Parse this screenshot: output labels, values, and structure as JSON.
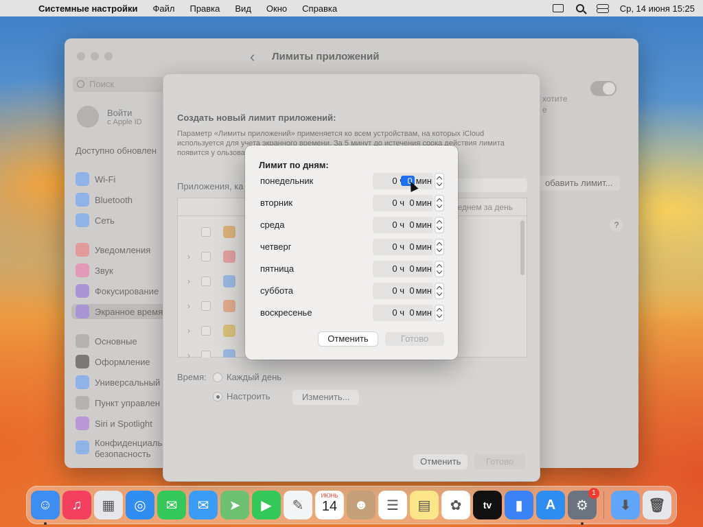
{
  "menubar": {
    "app_name": "Системные настройки",
    "items": [
      "Файл",
      "Правка",
      "Вид",
      "Окно",
      "Справка"
    ],
    "clock": "Ср, 14 июня  15:25"
  },
  "window": {
    "title": "Лимиты приложений",
    "search_placeholder": "Поиск",
    "account_name": "Войти",
    "account_sub": "с Apple ID",
    "update_note": "Доступно обновлен",
    "sidebar": [
      {
        "label": "Wi-Fi",
        "color": "#3b82f6"
      },
      {
        "label": "Bluetooth",
        "color": "#3b82f6"
      },
      {
        "label": "Сеть",
        "color": "#3b82f6"
      },
      {
        "label": "Уведомления",
        "color": "#ef4444"
      },
      {
        "label": "Звук",
        "color": "#ec4899"
      },
      {
        "label": "Фокусирование",
        "color": "#6d28d9"
      },
      {
        "label": "Экранное время",
        "color": "#7c3aed"
      },
      {
        "label": "Основные",
        "color": "#9ca3af"
      },
      {
        "label": "Оформление",
        "color": "#111827"
      },
      {
        "label": "Универсальный",
        "color": "#3b82f6"
      },
      {
        "label": "Пункт управлен",
        "color": "#9ca3af"
      },
      {
        "label": "Siri и Spotlight",
        "color": "#a855f7"
      },
      {
        "label": "Конфиденциаль",
        "color": "#3b82f6"
      },
      {
        "label": "безопасность",
        "color": ""
      }
    ],
    "right_hint_1": "хотите",
    "right_hint_2": "е",
    "add_limit": "обавить лимит...",
    "help": "?"
  },
  "sheet": {
    "title": "Создать новый лимит приложений:",
    "description": "Параметр «Лимиты приложений» применяется ко всем устройствам, на которых iCloud используется для учета экранного времени. За 5 минут до истечения срока действия лимита появится у                                                             ользовать на все приложения этой",
    "apps_label": "Приложения, ка",
    "table_header_right": "реднем за день",
    "time_label": "Время:",
    "every_day": "Каждый день",
    "custom": "Настроить",
    "change": "Изменить...",
    "cancel": "Отменить",
    "done": "Готово"
  },
  "dialog": {
    "title": "Лимит по дням:",
    "hours_unit": "ч",
    "minutes_unit": "мин",
    "days": [
      {
        "name": "понедельник",
        "hours": "0",
        "minutes": "0",
        "selected": true
      },
      {
        "name": "вторник",
        "hours": "0",
        "minutes": "0",
        "selected": false
      },
      {
        "name": "среда",
        "hours": "0",
        "minutes": "0",
        "selected": false
      },
      {
        "name": "четверг",
        "hours": "0",
        "minutes": "0",
        "selected": false
      },
      {
        "name": "пятница",
        "hours": "0",
        "minutes": "0",
        "selected": false
      },
      {
        "name": "суббота",
        "hours": "0",
        "minutes": "0",
        "selected": false
      },
      {
        "name": "воскресенье",
        "hours": "0",
        "minutes": "0",
        "selected": false
      }
    ],
    "cancel": "Отменить",
    "done": "Готово"
  },
  "dock": {
    "apps": [
      {
        "name": "finder-icon",
        "color": "#3d8ef0",
        "glyph": "☺",
        "running": true
      },
      {
        "name": "music-icon",
        "color": "#f43f5e",
        "glyph": "♫",
        "running": false
      },
      {
        "name": "launchpad-icon",
        "color": "#e5e7eb",
        "glyph": "▦",
        "running": false
      },
      {
        "name": "safari-icon",
        "color": "#2f8cf0",
        "glyph": "◎",
        "running": false
      },
      {
        "name": "messages-icon",
        "color": "#34c759",
        "glyph": "✉",
        "running": false
      },
      {
        "name": "mail-icon",
        "color": "#3b9bf5",
        "glyph": "✉",
        "running": false
      },
      {
        "name": "maps-icon",
        "color": "#6cc070",
        "glyph": "➤",
        "running": false
      },
      {
        "name": "facetime-icon",
        "color": "#34c759",
        "glyph": "▶",
        "running": false
      },
      {
        "name": "freeform-icon",
        "color": "#f3f4f6",
        "glyph": "✎",
        "running": false
      },
      {
        "name": "calendar-icon",
        "color": "#ffffff",
        "glyph": "",
        "running": false
      },
      {
        "name": "contacts-icon",
        "color": "#c4a07a",
        "glyph": "☻",
        "running": false
      },
      {
        "name": "reminders-icon",
        "color": "#ffffff",
        "glyph": "☰",
        "running": false
      },
      {
        "name": "notes-icon",
        "color": "#fde68a",
        "glyph": "▤",
        "running": false
      },
      {
        "name": "photos-icon",
        "color": "#ffffff",
        "glyph": "✿",
        "running": false
      },
      {
        "name": "tv-icon",
        "color": "#111111",
        "glyph": "tv",
        "running": false
      },
      {
        "name": "keynote-icon",
        "color": "#3b82f6",
        "glyph": "▮",
        "running": false
      },
      {
        "name": "appstore-icon",
        "color": "#2f8cf0",
        "glyph": "A",
        "running": false
      },
      {
        "name": "system-settings-icon",
        "color": "#6b7280",
        "glyph": "⚙",
        "running": true,
        "badge": "1"
      }
    ],
    "calendar_month": "ИЮНЬ",
    "calendar_day": "14",
    "trash": [
      {
        "name": "downloads-folder-icon",
        "color": "#60a5fa",
        "glyph": "⬇"
      },
      {
        "name": "trash-icon",
        "color": "#e5e7eb",
        "glyph": "🗑"
      }
    ]
  }
}
